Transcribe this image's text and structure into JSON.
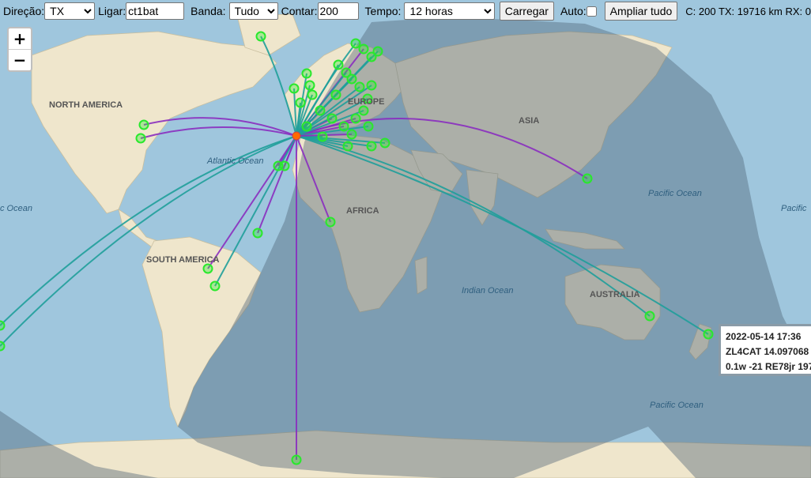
{
  "toolbar": {
    "direction_label": "Direção:",
    "direction_value": "TX",
    "call_label": "Ligar:",
    "call_value": "ct1bat",
    "band_label": "Banda:",
    "band_value": "Tudo",
    "count_label": "Contar:",
    "count_value": "200",
    "time_label": "Tempo:",
    "time_value": "12 horas",
    "load_button": "Carregar",
    "auto_label": "Auto:",
    "zoom_all_button": "Ampliar tudo",
    "stats": "C: 200 TX: 19716 km RX: 0"
  },
  "zoom": {
    "in": "+",
    "out": "−"
  },
  "map_labels": {
    "north_america": "NORTH AMERICA",
    "south_america": "SOUTH AMERICA",
    "europe": "EUROPE",
    "africa": "AFRICA",
    "asia": "ASIA",
    "australia": "AUSTRALIA",
    "atlantic_ocean": "Atlantic Ocean",
    "indian_ocean": "Indian Ocean",
    "pacific_ocean_ne": "Pacific Ocean",
    "pacific_ocean_se": "Pacific Ocean",
    "pacific_ocean_e_edge": "Pacific",
    "pacific_ocean_w_edge": "c Ocean"
  },
  "popup": {
    "line1": "2022-05-14 17:36",
    "line2": "ZL4CAT 14.097068",
    "line3": "0.1w -21 RE78jr 197"
  },
  "colors": {
    "ocean": "#9fc6dd",
    "land": "#efe6cc",
    "night_overlay": "#5b6f82",
    "path_teal": "#1f9e9a",
    "path_purple": "#8a2dbf",
    "marker_green": "#29e82c"
  }
}
